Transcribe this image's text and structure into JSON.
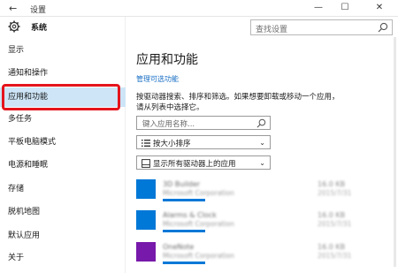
{
  "window": {
    "title": "设置",
    "back_glyph": "←",
    "min_glyph": "—",
    "max_glyph": "☐",
    "close_glyph": "✕"
  },
  "sidebar": {
    "header_label": "系统",
    "items": [
      {
        "label": "显示",
        "active": false
      },
      {
        "label": "通知和操作",
        "active": false
      },
      {
        "label": "应用和功能",
        "active": true
      },
      {
        "label": "多任务",
        "active": false
      },
      {
        "label": "平板电脑模式",
        "active": false
      },
      {
        "label": "电源和睡眠",
        "active": false
      },
      {
        "label": "存储",
        "active": false
      },
      {
        "label": "脱机地图",
        "active": false
      },
      {
        "label": "默认应用",
        "active": false
      },
      {
        "label": "关于",
        "active": false
      }
    ]
  },
  "search": {
    "placeholder": "查找设置"
  },
  "main": {
    "title": "应用和功能",
    "manage_link": "管理可选功能",
    "description_line1": "按驱动器搜索、排序和筛选。如果想要卸载或移动一个应用，",
    "description_line2": "请从列表中选择它。",
    "app_search_placeholder": "键入应用名称...",
    "sort_label": "按大小排序",
    "filter_label": "显示所有驱动器上的应用",
    "apps": [
      {
        "name": "3D Builder",
        "publisher": "Microsoft Corporation",
        "size": "16.0 KB",
        "date": "2015/7/31",
        "color": "#0078d7"
      },
      {
        "name": "Alarms & Clock",
        "publisher": "Microsoft Corporation",
        "size": "16.0 KB",
        "date": "2015/7/31",
        "color": "#0078d7"
      },
      {
        "name": "OneNote",
        "publisher": "Microsoft Corporation",
        "size": "16.0 KB",
        "date": "2015/7/31",
        "color": "#7719aa"
      }
    ]
  },
  "colors": {
    "accent": "#0078d7",
    "highlight": "#e5141c",
    "active_bg": "#cde5f7"
  }
}
